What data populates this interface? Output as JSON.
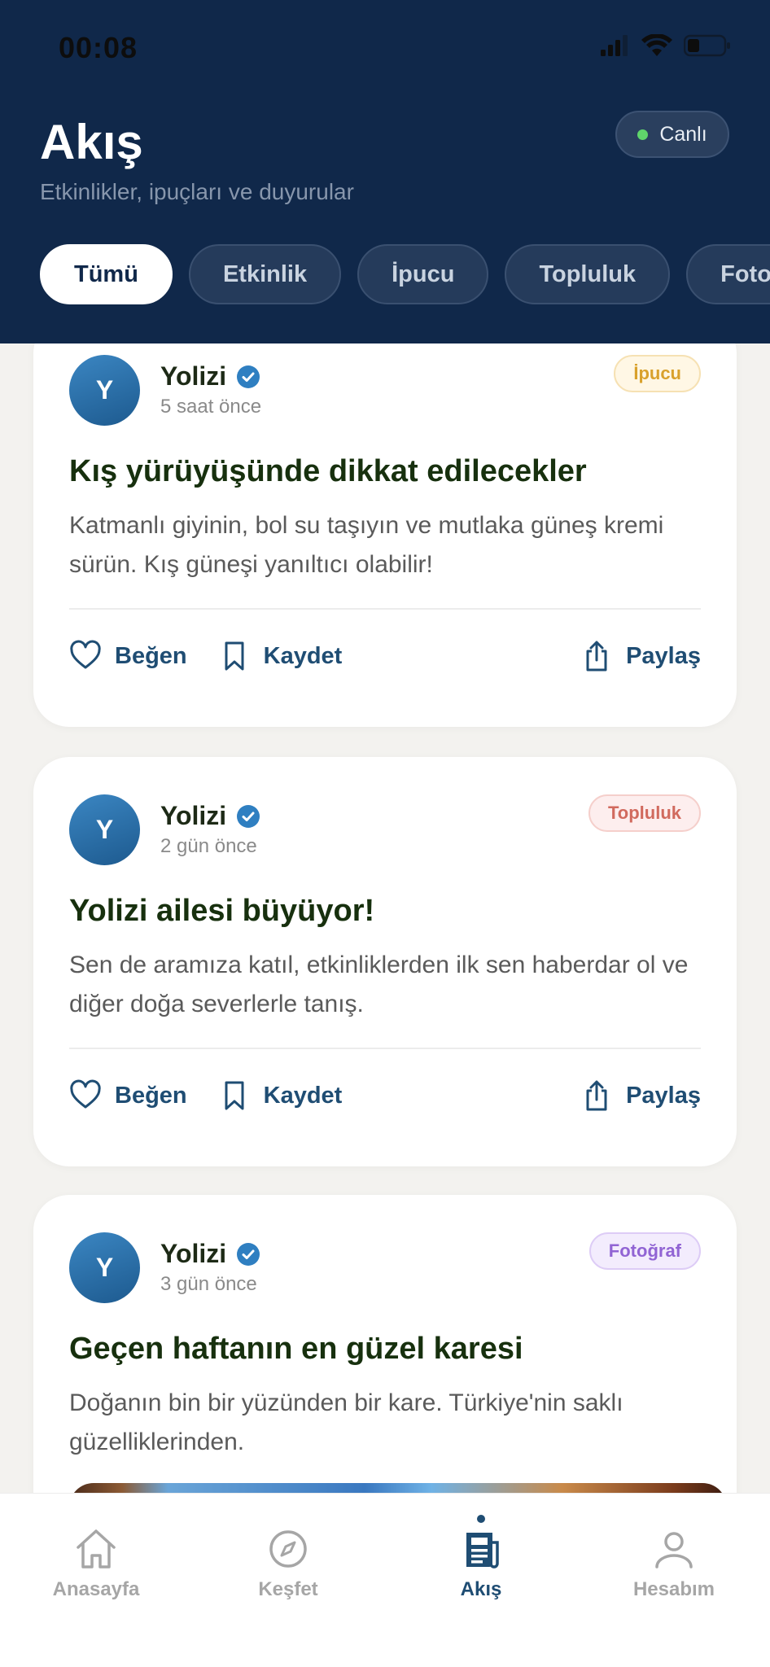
{
  "status_bar": {
    "time": "00:08"
  },
  "header": {
    "title": "Akış",
    "subtitle": "Etkinlikler, ipuçları ve duyurular",
    "live_label": "Canlı",
    "chips": [
      "Tümü",
      "Etkinlik",
      "İpucu",
      "Topluluk",
      "Foto"
    ]
  },
  "posts": [
    {
      "avatar_letter": "Y",
      "author": "Yolizi",
      "time": "5 saat önce",
      "tag": "İpucu",
      "title": "Kış yürüyüşünde dikkat edilecekler",
      "body": "Katmanlı giyinin, bol su taşıyın ve mutlaka güneş kremi sürün. Kış güneşi yanıltıcı olabilir!",
      "like_label": "Beğen",
      "save_label": "Kaydet",
      "share_label": "Paylaş"
    },
    {
      "avatar_letter": "Y",
      "author": "Yolizi",
      "time": "2 gün önce",
      "tag": "Topluluk",
      "title": "Yolizi ailesi büyüyor!",
      "body": "Sen de aramıza katıl, etkinliklerden ilk sen haberdar ol ve diğer doğa severlerle tanış.",
      "like_label": "Beğen",
      "save_label": "Kaydet",
      "share_label": "Paylaş"
    },
    {
      "avatar_letter": "Y",
      "author": "Yolizi",
      "time": "3 gün önce",
      "tag": "Fotoğraf",
      "title": "Geçen haftanın en güzel karesi",
      "body": "Doğanın bin bir yüzünden bir kare. Türkiye'nin saklı güzelliklerinden."
    }
  ],
  "bottom_nav": {
    "items": [
      "Anasayfa",
      "Keşfet",
      "Akış",
      "Hesabım"
    ],
    "active": "Akış"
  }
}
